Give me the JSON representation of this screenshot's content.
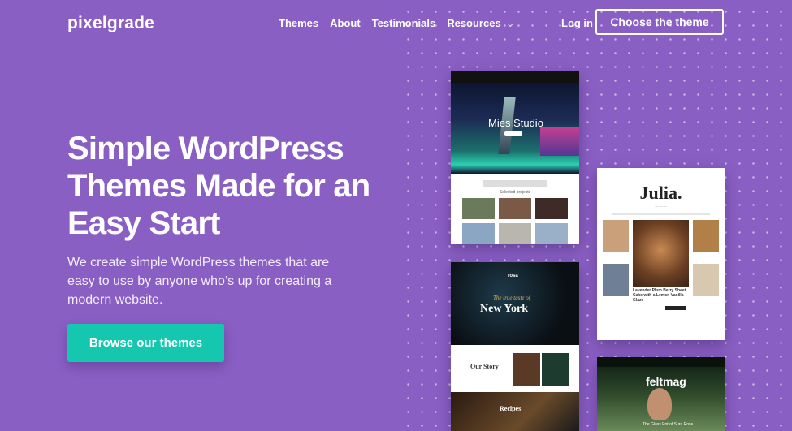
{
  "brand": {
    "logo": "pixelgrade"
  },
  "nav": {
    "items": [
      "Themes",
      "About",
      "Testimonials",
      "Resources"
    ],
    "resources_chevron": "chevron-down-icon",
    "login": "Log in",
    "cta": "Choose the theme"
  },
  "hero": {
    "title": "Simple WordPress Themes Made for an Easy Start",
    "subtitle": "We create simple WordPress themes that are easy to use by anyone who’s up for creating a modern website.",
    "button": "Browse our themes"
  },
  "previews": {
    "mies": {
      "title": "Mies Studio",
      "section": "Selected projects"
    },
    "julia": {
      "title": "Julia.",
      "feature": "Lavender Plum Berry Sheet Cake with a Lemon Vanilla Glaze"
    },
    "rosa": {
      "brand": "rosa",
      "tagline": "The true taste of",
      "title": "New York",
      "story": "Our Story",
      "recipes": "Recipes"
    },
    "felt": {
      "title": "feltmag",
      "caption": "The Glass Pot of Sura Rose"
    }
  },
  "colors": {
    "background": "#8a5fc4",
    "accent_button": "#16c7b0",
    "text": "#ffffff"
  }
}
